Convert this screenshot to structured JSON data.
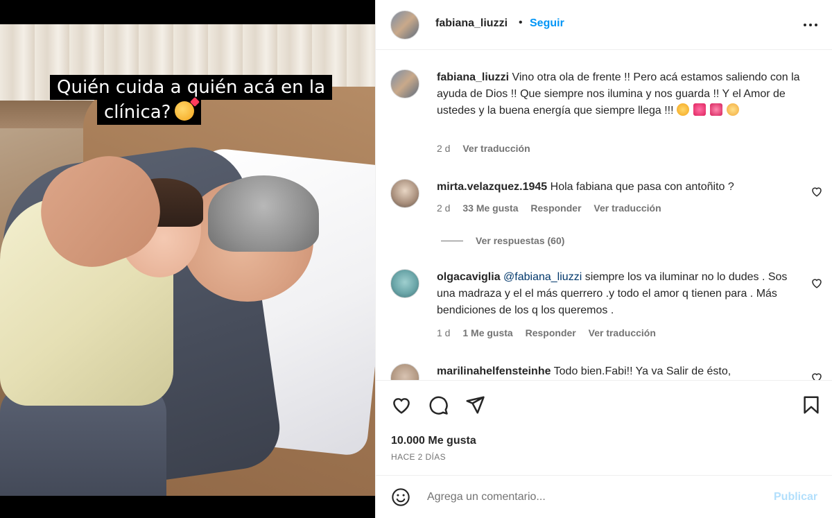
{
  "post": {
    "username": "fabiana_liuzzi",
    "dot": "•",
    "follow_label": "Seguir",
    "image_caption_line1": "Quién cuida a quién acá en la",
    "image_caption_line2": "clínica?"
  },
  "caption": {
    "username": "fabiana_liuzzi",
    "text": "Vino otra ola de frente !! Pero acá estamos saliendo con la ayuda de Dios !! Que siempre nos ilumina y nos guarda !! Y el Amor de ustedes y la buena energía que siempre llega !!!",
    "time": "2 d",
    "translate": "Ver traducción"
  },
  "comments": [
    {
      "username": "mirta.velazquez.1945",
      "text": "Hola fabiana que pasa con antoñito ?",
      "time": "2 d",
      "likes": "33 Me gusta",
      "reply": "Responder",
      "translate": "Ver traducción",
      "view_replies": "Ver respuestas (60)"
    },
    {
      "username": "olgacaviglia",
      "mention": "@fabiana_liuzzi",
      "text": "siempre los va iluminar no lo dudes . Sos una madraza y el el más querrero .y todo el amor q tienen para . Más bendiciones de los q los queremos .",
      "time": "1 d",
      "likes": "1 Me gusta",
      "reply": "Responder",
      "translate": "Ver traducción"
    },
    {
      "username": "marilinahelfensteinhe",
      "text": "Todo bien.Fabi!! Ya va Salir de ésto,"
    }
  ],
  "footer": {
    "likes": "10.000 Me gusta",
    "date": "HACE 2 DÍAS",
    "comment_placeholder": "Agrega un comentario...",
    "publish_label": "Publicar"
  },
  "colors": {
    "link_blue": "#0095f6",
    "publish_disabled": "#b2dffc",
    "muted": "#737373"
  }
}
